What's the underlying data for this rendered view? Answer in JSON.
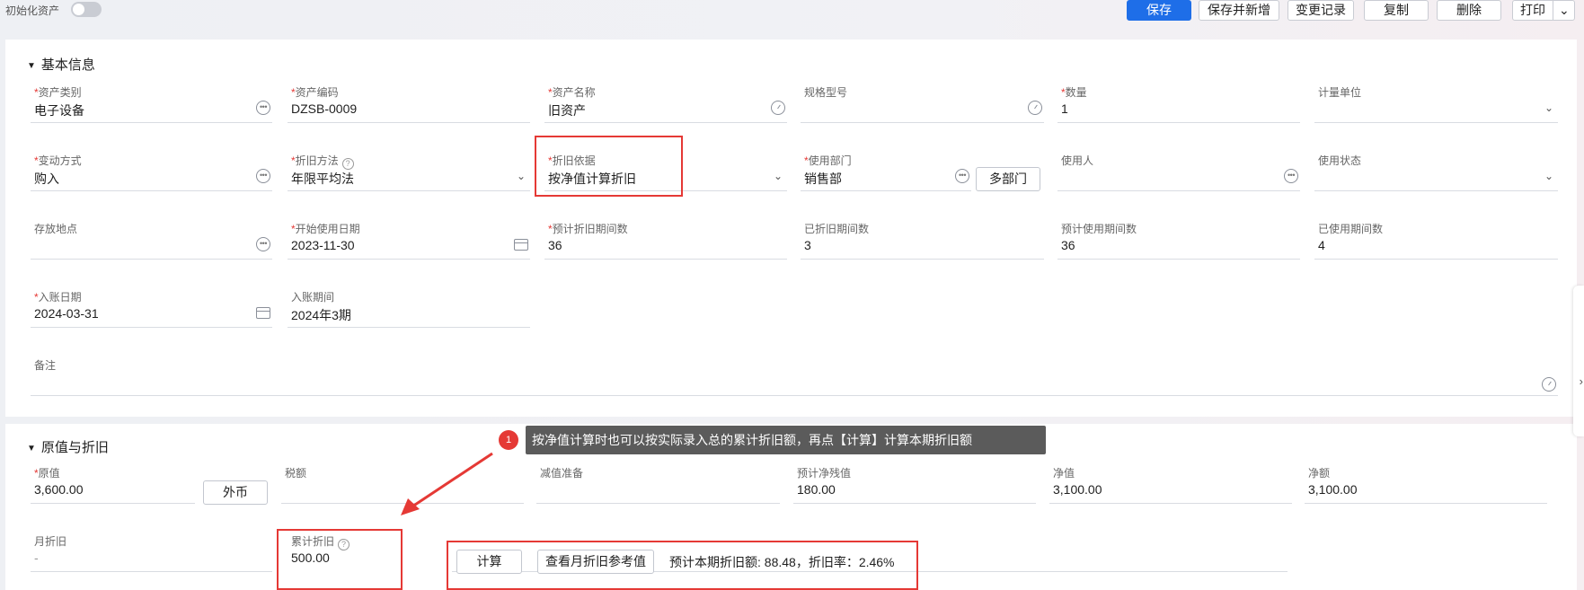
{
  "topbar": {
    "init_label": "初始化资产",
    "buttons": {
      "save": "保存",
      "save_new": "保存并新增",
      "changelog": "变更记录",
      "copy": "复制",
      "delete": "删除",
      "print": "打印",
      "print_caret": "⌄"
    }
  },
  "basic": {
    "title": "基本信息",
    "fields": {
      "category": {
        "label": "资产类别",
        "value": "电子设备"
      },
      "code": {
        "label": "资产编码",
        "value": "DZSB-0009"
      },
      "name": {
        "label": "资产名称",
        "value": "旧资产"
      },
      "spec": {
        "label": "规格型号",
        "value": ""
      },
      "qty": {
        "label": "数量",
        "value": "1"
      },
      "unit": {
        "label": "计量单位",
        "value": ""
      },
      "change_mode": {
        "label": "变动方式",
        "value": "购入"
      },
      "depr_method": {
        "label": "折旧方法",
        "value": "年限平均法"
      },
      "depr_basis": {
        "label": "折旧依据",
        "value": "按净值计算折旧"
      },
      "dept": {
        "label": "使用部门",
        "value": "销售部",
        "multi_btn": "多部门"
      },
      "user": {
        "label": "使用人",
        "value": ""
      },
      "status": {
        "label": "使用状态",
        "value": ""
      },
      "location": {
        "label": "存放地点",
        "value": ""
      },
      "start_date": {
        "label": "开始使用日期",
        "value": "2023-11-30"
      },
      "est_periods": {
        "label": "预计折旧期间数",
        "value": "36"
      },
      "depr_periods": {
        "label": "已折旧期间数",
        "value": "3"
      },
      "est_use_periods": {
        "label": "预计使用期间数",
        "value": "36"
      },
      "used_periods": {
        "label": "已使用期间数",
        "value": "4"
      },
      "post_date": {
        "label": "入账日期",
        "value": "2024-03-31"
      },
      "post_period": {
        "label": "入账期间",
        "value": "2024年3期"
      },
      "remark": {
        "label": "备注",
        "value": ""
      }
    }
  },
  "original": {
    "title": "原值与折旧",
    "fields": {
      "orig_value": {
        "label": "原值",
        "value": "3,600.00",
        "fx_btn": "外币"
      },
      "tax": {
        "label": "税额",
        "value": ""
      },
      "impairment": {
        "label": "减值准备",
        "value": ""
      },
      "residual": {
        "label": "预计净残值",
        "value": "180.00"
      },
      "net_value": {
        "label": "净值",
        "value": "3,100.00"
      },
      "net_amount": {
        "label": "净额",
        "value": "3,100.00"
      },
      "monthly": {
        "label": "月折旧",
        "value": "-"
      },
      "accum": {
        "label": "累计折旧",
        "value": "500.00"
      }
    },
    "calc_btn": "计算",
    "ref_btn": "查看月折旧参考值",
    "estimate": "预计本期折旧额: 88.48，折旧率：2.46%"
  },
  "callout": {
    "number": "1",
    "text": "按净值计算时也可以按实际录入总的累计折旧额，再点【计算】计算本期折旧额"
  },
  "colors": {
    "primary": "#1e6ee8",
    "highlight": "#e53935",
    "required": "#e53935"
  }
}
